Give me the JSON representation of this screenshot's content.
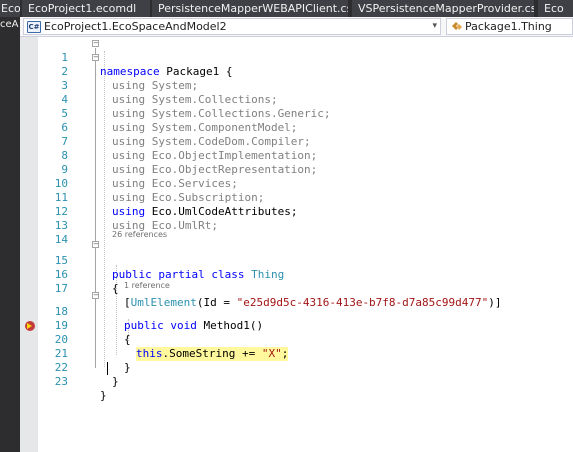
{
  "tabs": [
    "Eco",
    "EcoProject1.ecomdl",
    "PersistenceMapperWEBAPIClient.cs",
    "VSPersistenceMapperProvider.cs",
    "Eco"
  ],
  "left_strip_label": "ceA",
  "nav": {
    "project": "EcoProject1.EcoSpaceAndModel2",
    "member": "Package1.Thing",
    "project_icon": "C#"
  },
  "code_lens": {
    "class_refs": "26 references",
    "method_refs": "1 reference"
  },
  "lines": [
    {
      "n": "1",
      "t": "namespace Package1 {"
    },
    {
      "n": "2",
      "t": "using System;"
    },
    {
      "n": "3",
      "t": "using System.Collections;"
    },
    {
      "n": "4",
      "t": "using System.Collections.Generic;"
    },
    {
      "n": "5",
      "t": "using System.ComponentModel;"
    },
    {
      "n": "6",
      "t": "using System.CodeDom.Compiler;"
    },
    {
      "n": "7",
      "t": "using Eco.ObjectImplementation;"
    },
    {
      "n": "8",
      "t": "using Eco.ObjectRepresentation;"
    },
    {
      "n": "9",
      "t": "using Eco.Services;"
    },
    {
      "n": "10",
      "t": "using Eco.Subscription;"
    },
    {
      "n": "11",
      "t": "using Eco.UmlCodeAttributes;"
    },
    {
      "n": "12",
      "t": "using Eco.UmlRt;"
    },
    {
      "n": "13",
      "t": ""
    },
    {
      "n": "14",
      "t": ""
    },
    {
      "n": "15",
      "t": "public partial class Thing"
    },
    {
      "n": "16",
      "t": "{"
    },
    {
      "n": "17",
      "t": "[UmlElement(Id = \"e25d9d5c-4316-413e-b7f8-d7a85c99d477\")]"
    },
    {
      "n": "18",
      "t": "public void Method1()"
    },
    {
      "n": "19",
      "t": "{"
    },
    {
      "n": "20",
      "t": "this.SomeString += \"X\";"
    },
    {
      "n": "21",
      "t": "}"
    },
    {
      "n": "22",
      "t": "}"
    },
    {
      "n": "23",
      "t": "}"
    }
  ],
  "colors": {
    "keyword": "#0000ff",
    "type": "#2b91af",
    "string": "#a31515",
    "line_number": "#2b91af",
    "highlight": "#fff89c",
    "breakpoint": "#c23c3c"
  }
}
